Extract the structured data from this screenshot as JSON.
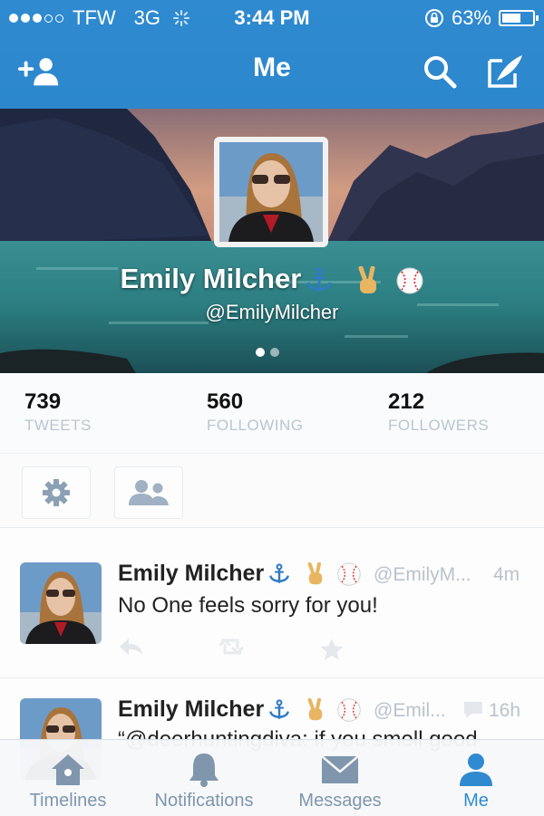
{
  "status_bar": {
    "carrier": "TFW",
    "network": "3G",
    "time": "3:44 PM",
    "battery": "63%",
    "battery_level": 0.63,
    "signal_bars_filled": 3,
    "signal_bars_total": 5
  },
  "nav": {
    "title": "Me",
    "left_icon": "add-user-icon",
    "right_icons": [
      "search-icon",
      "compose-icon"
    ]
  },
  "profile": {
    "name": "Emily Milcher",
    "name_emoji": [
      "anchor-emoji",
      "victory-hand-emoji",
      "baseball-emoji"
    ],
    "handle": "@EmilyMilcher",
    "pager_pages": 2,
    "pager_active": 0
  },
  "stats": [
    {
      "value": "739",
      "label": "TWEETS"
    },
    {
      "value": "560",
      "label": "FOLLOWING"
    },
    {
      "value": "212",
      "label": "FOLLOWERS"
    }
  ],
  "profile_actions": {
    "settings_icon": "gear-icon",
    "people_icon": "people-icon"
  },
  "tweets": [
    {
      "name": "Emily Milcher",
      "handle": "@EmilyM...",
      "time": "4m",
      "text": "No One feels sorry for you!"
    },
    {
      "name": "Emily Milcher",
      "handle": "@Emil...",
      "time": "16h",
      "text": "“@deerhuntingdiva: if you smell good"
    }
  ],
  "tabbar": {
    "tabs": [
      {
        "label": "Timelines",
        "icon": "home-icon"
      },
      {
        "label": "Notifications",
        "icon": "bell-icon"
      },
      {
        "label": "Messages",
        "icon": "envelope-icon"
      },
      {
        "label": "Me",
        "icon": "person-icon"
      }
    ],
    "active_index": 3
  },
  "colors": {
    "brand_blue": "#2f8ad0",
    "tab_inactive": "#7f96ad",
    "meta_gray": "#b9c3cc"
  }
}
